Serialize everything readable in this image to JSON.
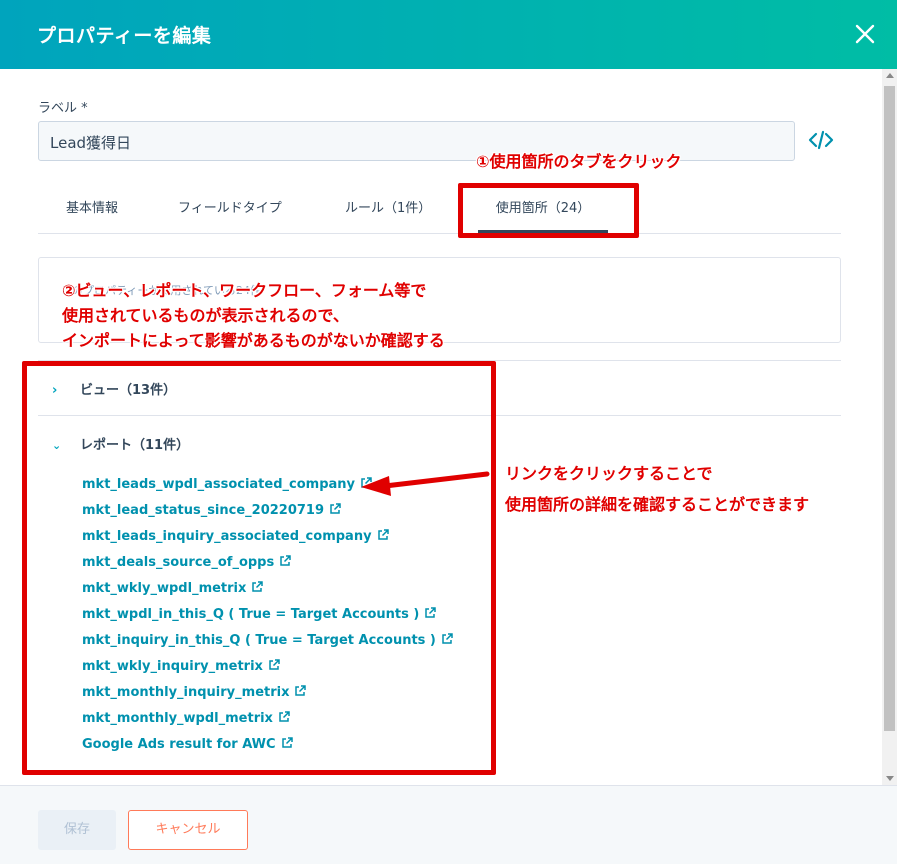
{
  "header": {
    "title": "プロパティーを編集"
  },
  "form": {
    "label_text": "ラベル *",
    "label_value": "Lead獲得日"
  },
  "tabs": [
    {
      "label": "基本情報"
    },
    {
      "label": "フィールドタイプ"
    },
    {
      "label": "ルール（1件）"
    },
    {
      "label": "使用箇所（24）"
    }
  ],
  "info_box": {
    "faint_text": "このプロパティーが使用されている24件"
  },
  "sections": {
    "views": {
      "label": "ビュー（13件）",
      "state": "collapsed"
    },
    "reports": {
      "label": "レポート（11件）",
      "state": "expanded"
    }
  },
  "reports": [
    "mkt_leads_wpdl_associated_company",
    "mkt_lead_status_since_20220719",
    "mkt_leads_inquiry_associated_company",
    "mkt_deals_source_of_opps",
    "mkt_wkly_wpdl_metrix",
    "mkt_wpdl_in_this_Q ( True = Target Accounts )",
    "mkt_inquiry_in_this_Q ( True = Target Accounts )",
    "mkt_wkly_inquiry_metrix",
    "mkt_monthly_inquiry_metrix",
    "mkt_monthly_wpdl_metrix",
    "Google Ads result for AWC"
  ],
  "footer": {
    "save_label": "保存",
    "cancel_label": "キャンセル"
  },
  "annotations": {
    "step1": "①使用箇所のタブをクリック",
    "step2_line1": "②ビュー、レポート、ワークフロー、フォーム等で",
    "step2_line2": "使用されているものが表示されるので、",
    "step2_line3": "インポートによって影響があるものがないか確認する",
    "step3_line1": "リンクをクリックすることで",
    "step3_line2": "使用箇所の詳細を確認することができます"
  },
  "colors": {
    "header_gradient_start": "#00a4bd",
    "header_gradient_end": "#00bda5",
    "link": "#0091ae",
    "annotation_red": "#e00000",
    "cancel_orange": "#ff7a59"
  }
}
